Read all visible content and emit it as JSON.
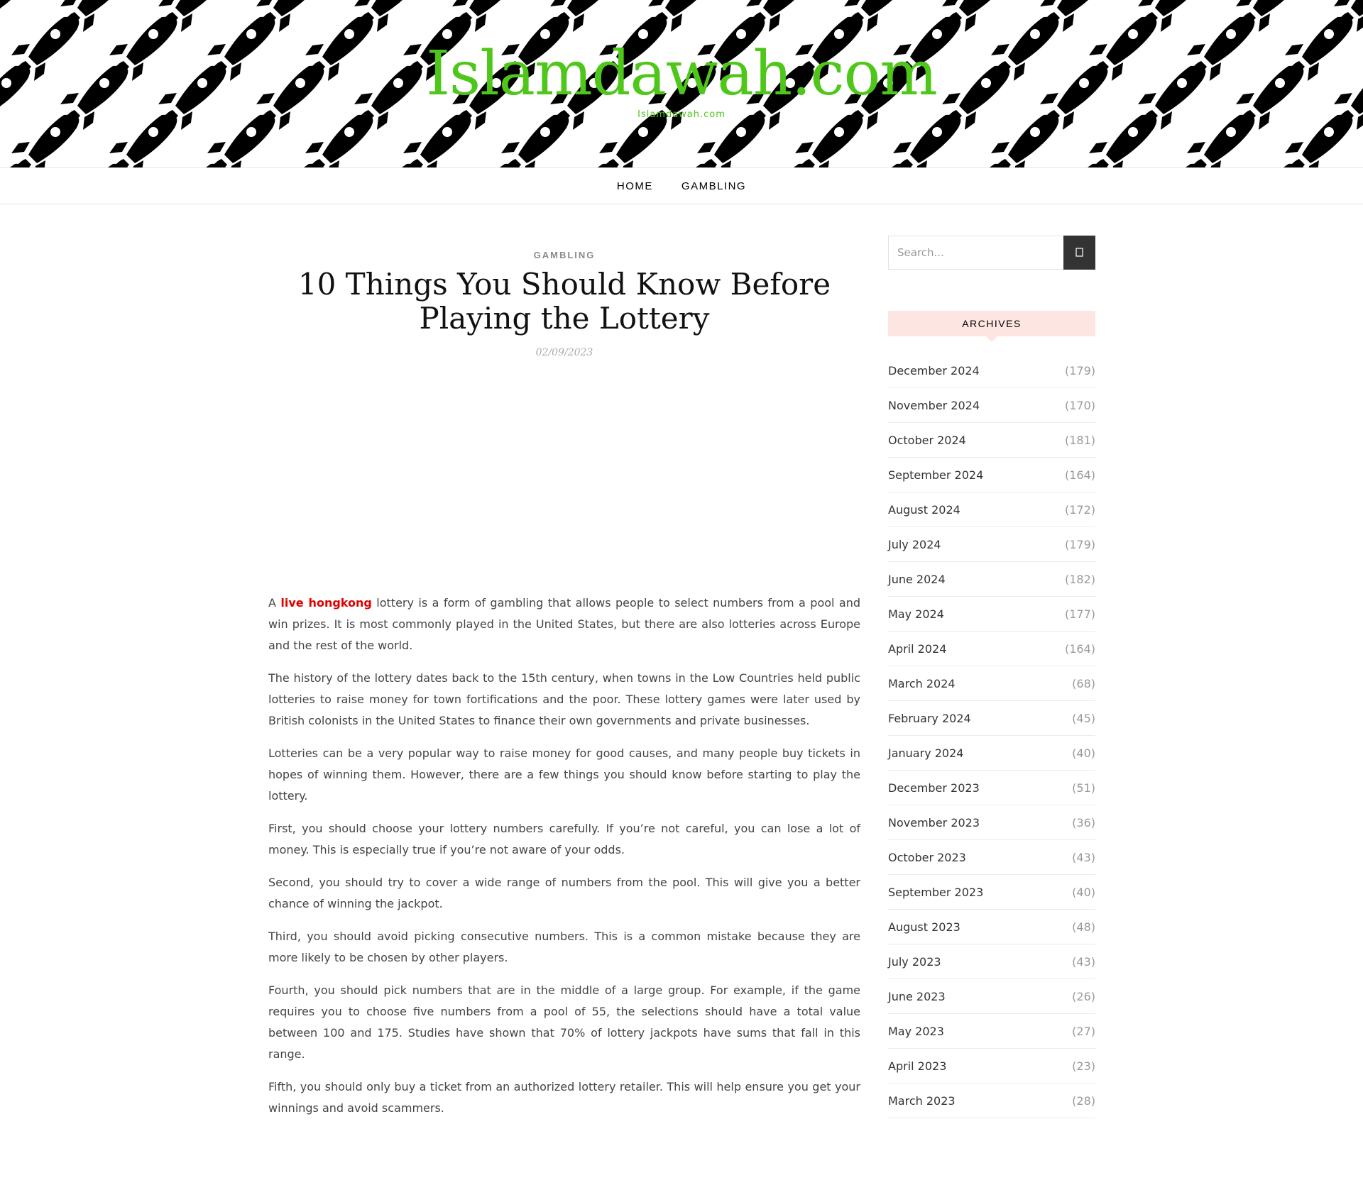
{
  "site": {
    "title": "Islamdawah.com",
    "tagline": "Islamdawah.com"
  },
  "nav": {
    "items": [
      {
        "label": "HOME"
      },
      {
        "label": "GAMBLING"
      }
    ]
  },
  "post": {
    "category": "GAMBLING",
    "title": "10 Things You Should Know Before Playing the Lottery",
    "date": "02/09/2023",
    "intro_prefix": "A",
    "intro_link": "live hongkong",
    "intro_rest": "lottery is a form of gambling that allows people to select numbers from a pool and win prizes. It is most commonly played in the United States, but there are also lotteries across Europe and the rest of the world.",
    "paragraphs": [
      "The history of the lottery dates back to the 15th century, when towns in the Low Countries held public lotteries to raise money for town fortifications and the poor. These lottery games were later used by British colonists in the United States to finance their own governments and private businesses.",
      "Lotteries can be a very popular way to raise money for good causes, and many people buy tickets in hopes of winning them. However, there are a few things you should know before starting to play the lottery.",
      "First, you should choose your lottery numbers carefully. If you’re not careful, you can lose a lot of money. This is especially true if you’re not aware of your odds.",
      "Second, you should try to cover a wide range of numbers from the pool. This will give you a better chance of winning the jackpot.",
      "Third, you should avoid picking consecutive numbers. This is a common mistake because they are more likely to be chosen by other players.",
      "Fourth, you should pick numbers that are in the middle of a large group. For example, if the game requires you to choose five numbers from a pool of 55, the selections should have a total value between 100 and 175. Studies have shown that 70% of lottery jackpots have sums that fall in this range.",
      "Fifth, you should only buy a ticket from an authorized lottery retailer. This will help ensure you get your winnings and avoid scammers."
    ]
  },
  "sidebar": {
    "search_placeholder": "Search...",
    "search_icon": "search-icon",
    "archives_title": "ARCHIVES",
    "archives": [
      {
        "month": "December 2024",
        "count": "(179)"
      },
      {
        "month": "November 2024",
        "count": "(170)"
      },
      {
        "month": "October 2024",
        "count": "(181)"
      },
      {
        "month": "September 2024",
        "count": "(164)"
      },
      {
        "month": "August 2024",
        "count": "(172)"
      },
      {
        "month": "July 2024",
        "count": "(179)"
      },
      {
        "month": "June 2024",
        "count": "(182)"
      },
      {
        "month": "May 2024",
        "count": "(177)"
      },
      {
        "month": "April 2024",
        "count": "(164)"
      },
      {
        "month": "March 2024",
        "count": "(68)"
      },
      {
        "month": "February 2024",
        "count": "(45)"
      },
      {
        "month": "January 2024",
        "count": "(40)"
      },
      {
        "month": "December 2023",
        "count": "(51)"
      },
      {
        "month": "November 2023",
        "count": "(36)"
      },
      {
        "month": "October 2023",
        "count": "(43)"
      },
      {
        "month": "September 2023",
        "count": "(40)"
      },
      {
        "month": "August 2023",
        "count": "(48)"
      },
      {
        "month": "July 2023",
        "count": "(43)"
      },
      {
        "month": "June 2023",
        "count": "(26)"
      },
      {
        "month": "May 2023",
        "count": "(27)"
      },
      {
        "month": "April 2023",
        "count": "(23)"
      },
      {
        "month": "March 2023",
        "count": "(28)"
      }
    ]
  },
  "colors": {
    "brand_green": "#4ec71a",
    "link_red": "#e00000",
    "widget_title_bg": "#fde6e1",
    "search_button_bg": "#333333"
  }
}
